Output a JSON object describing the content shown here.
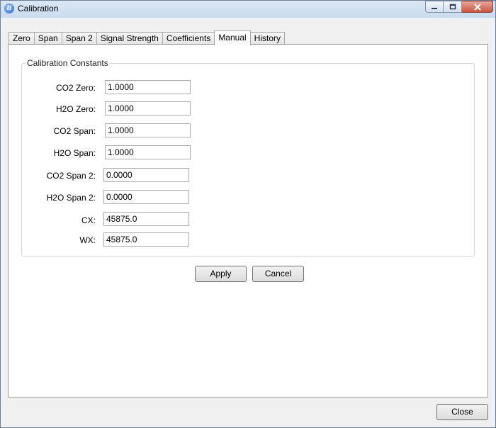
{
  "window": {
    "title": "Calibration",
    "icon": "app-logo-icon"
  },
  "tabs": [
    {
      "label": "Zero"
    },
    {
      "label": "Span"
    },
    {
      "label": "Span 2"
    },
    {
      "label": "Signal Strength"
    },
    {
      "label": "Coefficients"
    },
    {
      "label": "Manual",
      "active": true
    },
    {
      "label": "History"
    }
  ],
  "group": {
    "title": "Calibration Constants",
    "fields": [
      {
        "label": "CO2 Zero:",
        "value": "1.0000"
      },
      {
        "label": "H2O Zero:",
        "value": "1.0000"
      },
      {
        "label": "CO2 Span:",
        "value": "1.0000"
      },
      {
        "label": "H2O Span:",
        "value": "1.0000"
      },
      {
        "label": "CO2 Span 2:",
        "value": "0.0000"
      },
      {
        "label": "H2O Span 2:",
        "value": "0.0000"
      },
      {
        "label": "CX:",
        "value": "45875.0"
      },
      {
        "label": "WX:",
        "value": "45875.0"
      }
    ]
  },
  "buttons": {
    "apply": "Apply",
    "cancel": "Cancel",
    "close": "Close"
  }
}
